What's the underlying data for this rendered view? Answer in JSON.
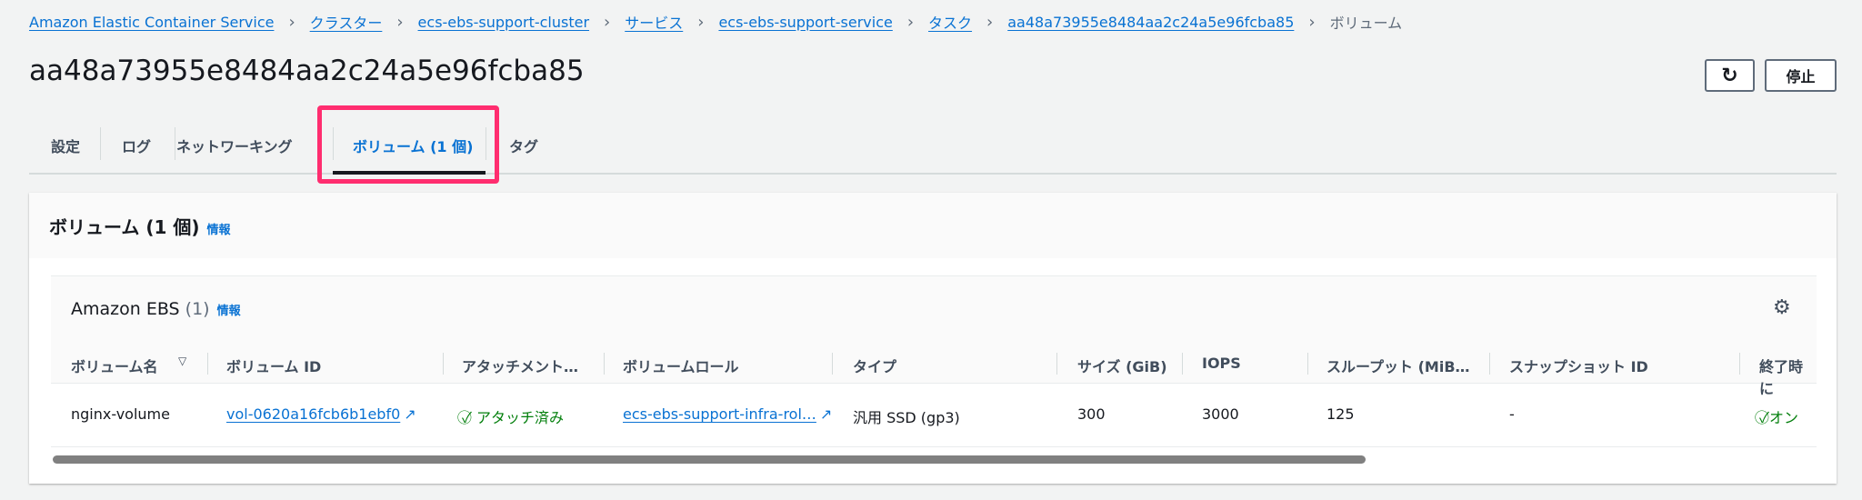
{
  "breadcrumb": [
    "Amazon Elastic Container Service",
    "クラスター",
    "ecs-ebs-support-cluster",
    "サービス",
    "ecs-ebs-support-service",
    "タスク",
    "aa48a73955e8484aa2c24a5e96fcba85",
    "ボリューム"
  ],
  "title": "aa48a73955e8484aa2c24a5e96fcba85",
  "actions": {
    "refresh_icon": "refresh-icon",
    "stop": "停止"
  },
  "tabs": [
    "設定",
    "ログ",
    "ネットワーキング",
    "ボリューム (1 個)",
    "タグ"
  ],
  "panel": {
    "title": "ボリューム (1 個)",
    "info": "情報"
  },
  "table": {
    "title": "Amazon EBS",
    "count": "(1)",
    "info": "情報",
    "columns": [
      "ボリューム名",
      "ボリューム ID",
      "アタッチメント…",
      "ボリュームロール",
      "タイプ",
      "サイズ (GiB)",
      "IOPS",
      "スループット (MiB…",
      "スナップショット ID",
      "終了時に"
    ],
    "row": {
      "name": "nginx-volume",
      "id": "vol-0620a16fcb6b1ebf0",
      "attachment": "アタッチ済み",
      "role": "ecs-ebs-support-infra-rol…",
      "type": "汎用 SSD (gp3)",
      "size": "300",
      "iops": "3000",
      "throughput": "125",
      "snapshot": "-",
      "delete": "オン"
    }
  },
  "colors": {
    "accent": "#0972d3",
    "highlight": "#ff2d6f",
    "success": "#037f0c"
  }
}
